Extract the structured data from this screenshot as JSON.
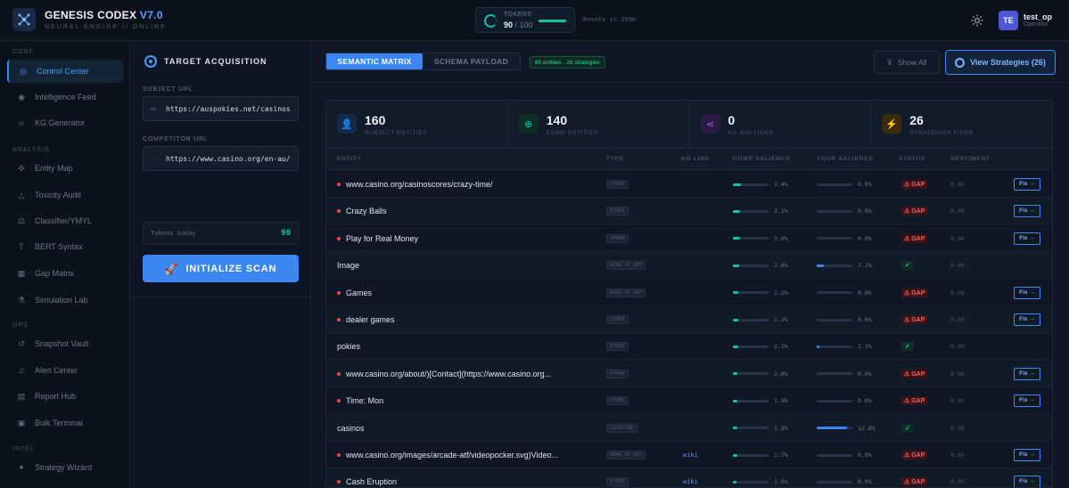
{
  "header": {
    "brand": "GENESIS CODEX",
    "version": "V7.0",
    "subtitle": "NEURAL ENGINE // ONLINE",
    "tokens_label": "TOKENS",
    "tokens_used": "90",
    "tokens_max": "/ 100",
    "tokens_fraction": 0.9,
    "reset_text": "Resets in 3h9m",
    "user_initials": "TE",
    "user_name": "test_op",
    "user_role": "Operator"
  },
  "sidebar": {
    "sections": [
      "CORE",
      "ANALYSIS",
      "OPS",
      "INTEL"
    ],
    "items": [
      {
        "label": "Control Center",
        "icon": "target-icon"
      },
      {
        "label": "Intelligence Feed",
        "icon": "radar-icon"
      },
      {
        "label": "KG Generator",
        "icon": "code-icon"
      },
      {
        "label": "Entity Map",
        "icon": "network-icon"
      },
      {
        "label": "Toxicity Audit",
        "icon": "warning-icon"
      },
      {
        "label": "Classifier/YMYL",
        "icon": "scale-icon"
      },
      {
        "label": "BERT Syntax",
        "icon": "text-icon"
      },
      {
        "label": "Gap Matrix",
        "icon": "grid-icon"
      },
      {
        "label": "Simulation Lab",
        "icon": "flask-icon"
      },
      {
        "label": "Snapshot Vault",
        "icon": "history-icon"
      },
      {
        "label": "Alert Center",
        "icon": "bell-icon"
      },
      {
        "label": "Report Hub",
        "icon": "document-icon"
      },
      {
        "label": "Bulk Terminal",
        "icon": "terminal-icon"
      },
      {
        "label": "Strategy Wizard",
        "icon": "wand-icon"
      }
    ]
  },
  "panel": {
    "title": "TARGET ACQUISITION",
    "subject_label": "SUBJECT URL",
    "subject_value": "https://auspokies.net/casinos",
    "competitor_label": "COMPETITOR URL",
    "competitor_value": "https://www.casino.org/en-au/casinos",
    "budget_label": "Tokens today",
    "budget_value": "90",
    "scan_label": "INITIALIZE SCAN"
  },
  "main": {
    "tab_active": "SEMANTIC MATRIX",
    "tab_inactive": "SCHEMA PAYLOAD",
    "entity_badge": "60 entities · 26 strategies",
    "show_all": "Show All",
    "view_strategies": "View Strategies (26)",
    "stats": [
      {
        "value": "160",
        "label": "SUBJECT ENTITIES",
        "icon": "user-icon",
        "color": "#3b86f0"
      },
      {
        "value": "140",
        "label": "COMP ENTITIES",
        "icon": "crosshair-icon",
        "color": "#19c29b"
      },
      {
        "value": "0",
        "label": "KG MID LINKS",
        "icon": "share-icon",
        "color": "#a35cf0"
      },
      {
        "value": "26",
        "label": "STRATEGIES FIRED",
        "icon": "bolt-icon",
        "color": "#f0a030"
      }
    ],
    "columns": [
      "ENTITY",
      "TYPE",
      "KG LINK",
      "COMP SALIENCE",
      "YOUR SALIENCE",
      "STATUS",
      "SENTIMENT"
    ],
    "rows": [
      {
        "entity": "www.casino.org/casinoscores/crazy-time/",
        "gap": true,
        "type": "OTHER",
        "kg": "",
        "comp": "3.4%",
        "comp_v": 3.4,
        "yours": "0.0%",
        "yours_v": 0.0,
        "status": "⚠ GAP",
        "sentiment": "0.00",
        "fix": "Fix →"
      },
      {
        "entity": "Crazy Balls",
        "gap": true,
        "type": "OTHER",
        "kg": "",
        "comp": "3.1%",
        "comp_v": 3.1,
        "yours": "0.0%",
        "yours_v": 0.0,
        "status": "⚠ GAP",
        "sentiment": "0.00",
        "fix": "Fix →"
      },
      {
        "entity": "Play for Real Money",
        "gap": true,
        "type": "OTHER",
        "kg": "",
        "comp": "3.0%",
        "comp_v": 3.0,
        "yours": "0.0%",
        "yours_v": 0.0,
        "status": "⚠ GAP",
        "sentiment": "0.00",
        "fix": "Fix →"
      },
      {
        "entity": "Image",
        "gap": false,
        "type": "WORK_OF_ART",
        "kg": "",
        "comp": "2.8%",
        "comp_v": 2.8,
        "yours": "3.1%",
        "yours_v": 3.1,
        "status": "✓",
        "sentiment": "0.00",
        "fix": ""
      },
      {
        "entity": "Games",
        "gap": true,
        "type": "WORK_OF_ART",
        "kg": "",
        "comp": "2.2%",
        "comp_v": 2.2,
        "yours": "0.0%",
        "yours_v": 0.0,
        "status": "⚠ GAP",
        "sentiment": "0.00",
        "fix": "Fix →"
      },
      {
        "entity": "dealer games",
        "gap": true,
        "type": "OTHER",
        "kg": "",
        "comp": "2.2%",
        "comp_v": 2.2,
        "yours": "0.0%",
        "yours_v": 0.0,
        "status": "⚠ GAP",
        "sentiment": "0.00",
        "fix": "Fix →"
      },
      {
        "entity": "pokies",
        "gap": false,
        "type": "OTHER",
        "kg": "",
        "comp": "2.1%",
        "comp_v": 2.1,
        "yours": "1.2%",
        "yours_v": 1.2,
        "status": "✓",
        "sentiment": "0.00",
        "fix": ""
      },
      {
        "entity": "www.casino.org/about/)[Contact](https://www.casino.org...",
        "gap": true,
        "type": "OTHER",
        "kg": "",
        "comp": "2.0%",
        "comp_v": 2.0,
        "yours": "0.0%",
        "yours_v": 0.0,
        "status": "⚠ GAP",
        "sentiment": "0.00",
        "fix": "Fix →"
      },
      {
        "entity": "Time: Mon",
        "gap": true,
        "type": "OTHER",
        "kg": "",
        "comp": "1.9%",
        "comp_v": 1.9,
        "yours": "0.0%",
        "yours_v": 0.0,
        "status": "⚠ GAP",
        "sentiment": "0.00",
        "fix": "Fix →"
      },
      {
        "entity": "casinos",
        "gap": false,
        "type": "LOCATION",
        "kg": "",
        "comp": "1.8%",
        "comp_v": 1.8,
        "yours": "12.6%",
        "yours_v": 12.6,
        "status": "✓",
        "sentiment": "0.00",
        "fix": ""
      },
      {
        "entity": "www.casino.org/images/arcade-atf/videopocker.svg)Video...",
        "gap": true,
        "type": "WORK_OF_ART",
        "kg": "wiki",
        "comp": "1.7%",
        "comp_v": 1.7,
        "yours": "0.0%",
        "yours_v": 0.0,
        "status": "⚠ GAP",
        "sentiment": "0.00",
        "fix": "Fix →"
      },
      {
        "entity": "Cash Eruption",
        "gap": true,
        "type": "OTHER",
        "kg": "wiki",
        "comp": "1.6%",
        "comp_v": 1.6,
        "yours": "0.0%",
        "yours_v": 0.0,
        "status": "⚠ GAP",
        "sentiment": "0.00",
        "fix": "Fix →"
      }
    ]
  }
}
